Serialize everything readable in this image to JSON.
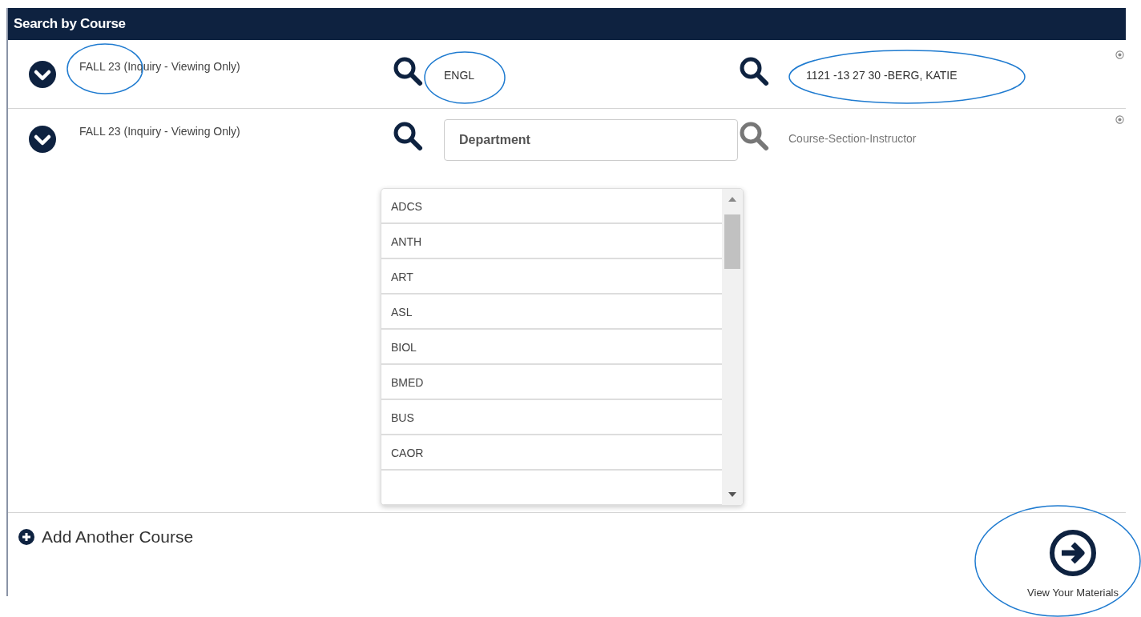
{
  "panel": {
    "title": "Search by Course"
  },
  "rows": [
    {
      "term": "FALL 23 (Inquiry - Viewing Only)",
      "department": {
        "value": "ENGL"
      },
      "course": {
        "value": "1121 -13 27 30 -BERG, KATIE"
      }
    },
    {
      "term": "FALL 23 (Inquiry - Viewing Only)",
      "department": {
        "placeholder": "Department",
        "expanded": true,
        "options": [
          "ADCS",
          "ANTH",
          "ART",
          "ASL",
          "BIOL",
          "BMED",
          "BUS",
          "CAOR"
        ]
      },
      "course": {
        "placeholder": "Course-Section-Instructor"
      }
    }
  ],
  "add_link": "Add Another Course",
  "submit": "View Your Materials"
}
